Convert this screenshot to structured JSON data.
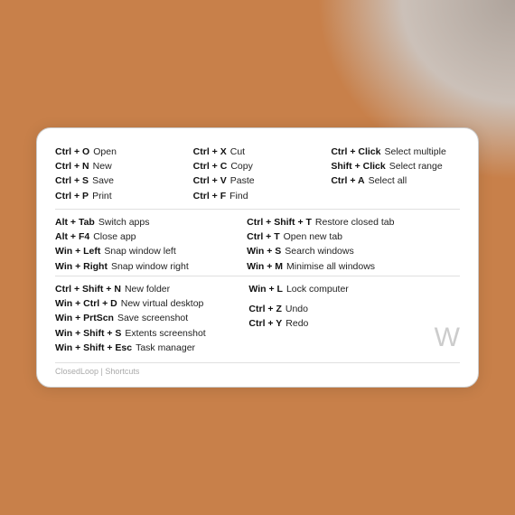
{
  "card": {
    "footer": "ClosedLoop | Shortcuts",
    "logo": "W",
    "sections": {
      "top": {
        "col1": [
          {
            "key": "Ctrl + O",
            "desc": "Open"
          },
          {
            "key": "Ctrl + N",
            "desc": "New"
          },
          {
            "key": "Ctrl + S",
            "desc": "Save"
          },
          {
            "key": "Ctrl + P",
            "desc": "Print"
          }
        ],
        "col2": [
          {
            "key": "Ctrl + X",
            "desc": "Cut"
          },
          {
            "key": "Ctrl + C",
            "desc": "Copy"
          },
          {
            "key": "Ctrl + V",
            "desc": "Paste"
          },
          {
            "key": "Ctrl + F",
            "desc": "Find"
          }
        ],
        "col3": [
          {
            "key": "Ctrl + Click",
            "desc": "Select multiple"
          },
          {
            "key": "Shift + Click",
            "desc": "Select range"
          },
          {
            "key": "Ctrl + A",
            "desc": "Select all"
          },
          {
            "key": "",
            "desc": ""
          }
        ]
      },
      "mid": {
        "col1": [
          {
            "key": "Alt + Tab",
            "desc": "Switch apps"
          },
          {
            "key": "Alt + F4",
            "desc": "Close app"
          },
          {
            "key": "Win + Left",
            "desc": "Snap window left"
          },
          {
            "key": "Win + Right",
            "desc": "Snap window right"
          }
        ],
        "col2": [
          {
            "key": "Ctrl + Shift + T",
            "desc": "Restore closed tab"
          },
          {
            "key": "Ctrl + T",
            "desc": "Open new tab"
          },
          {
            "key": "Win + S",
            "desc": "Search windows"
          },
          {
            "key": "Win + M",
            "desc": "Minimise all windows"
          }
        ]
      },
      "bot": {
        "col1": [
          {
            "key": "Ctrl + Shift + N",
            "desc": "New folder"
          },
          {
            "key": "Win + Ctrl + D",
            "desc": "New virtual desktop"
          },
          {
            "key": "Win + PrtScn",
            "desc": "Save screenshot"
          },
          {
            "key": "Win + Shift + S",
            "desc": "Extents screenshot"
          },
          {
            "key": "Win + Shift + Esc",
            "desc": "Task manager"
          }
        ],
        "col2": [
          {
            "key": "Win + L",
            "desc": "Lock computer"
          },
          {
            "key": "",
            "desc": ""
          },
          {
            "key": "Ctrl + Z",
            "desc": "Undo"
          },
          {
            "key": "Ctrl + Y",
            "desc": "Redo"
          }
        ]
      }
    }
  }
}
